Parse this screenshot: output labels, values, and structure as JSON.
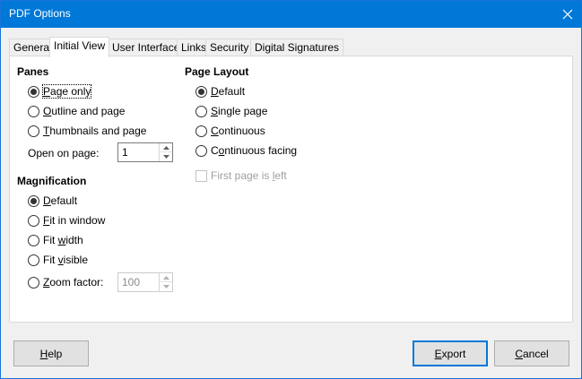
{
  "window": {
    "title": "PDF Options"
  },
  "icons": {
    "close": "close-icon",
    "spin_up": "chevron-up-icon",
    "spin_down": "chevron-down-icon"
  },
  "tabs": [
    {
      "label": "General",
      "active": false
    },
    {
      "label": "Initial View",
      "active": true
    },
    {
      "label": "User Interface",
      "active": false
    },
    {
      "label": "Links",
      "active": false
    },
    {
      "label": "Security",
      "active": false
    },
    {
      "label": "Digital Signatures",
      "active": false
    }
  ],
  "panes": {
    "title": "Panes",
    "options": [
      {
        "prefix": "",
        "mnemonic": "P",
        "rest": "age only",
        "checked": true
      },
      {
        "prefix": "",
        "mnemonic": "O",
        "rest": "utline and page",
        "checked": false
      },
      {
        "prefix": "",
        "mnemonic": "T",
        "rest": "humbnails and page",
        "checked": false
      }
    ],
    "open_on_page": {
      "prefix": "Open on pa",
      "mnemonic": "g",
      "rest": "e:",
      "value": "1"
    }
  },
  "magnification": {
    "title": "Magnification",
    "options": [
      {
        "prefix": "",
        "mnemonic": "D",
        "rest": "efault",
        "checked": true
      },
      {
        "prefix": "",
        "mnemonic": "F",
        "rest": "it in window",
        "checked": false
      },
      {
        "prefix": "Fit ",
        "mnemonic": "w",
        "rest": "idth",
        "checked": false
      },
      {
        "prefix": "Fit ",
        "mnemonic": "v",
        "rest": "isible",
        "checked": false
      },
      {
        "prefix": "",
        "mnemonic": "Z",
        "rest": "oom factor:",
        "checked": false
      }
    ],
    "zoom_value": "100"
  },
  "page_layout": {
    "title": "Page Layout",
    "options": [
      {
        "prefix": "",
        "mnemonic": "D",
        "rest": "efault",
        "checked": true
      },
      {
        "prefix": "",
        "mnemonic": "S",
        "rest": "ingle page",
        "checked": false
      },
      {
        "prefix": "",
        "mnemonic": "C",
        "rest": "ontinuous",
        "checked": false
      },
      {
        "prefix": "C",
        "mnemonic": "o",
        "rest": "ntinuous facing",
        "checked": false
      }
    ],
    "first_page_left": {
      "prefix": "First page is ",
      "mnemonic": "l",
      "rest": "eft",
      "checked": false,
      "enabled": false
    }
  },
  "buttons": {
    "help": {
      "prefix": "",
      "mnemonic": "H",
      "rest": "elp"
    },
    "export": {
      "prefix": "",
      "mnemonic": "E",
      "rest": "xport"
    },
    "cancel": {
      "prefix": "",
      "mnemonic": "C",
      "rest": "ancel"
    }
  }
}
